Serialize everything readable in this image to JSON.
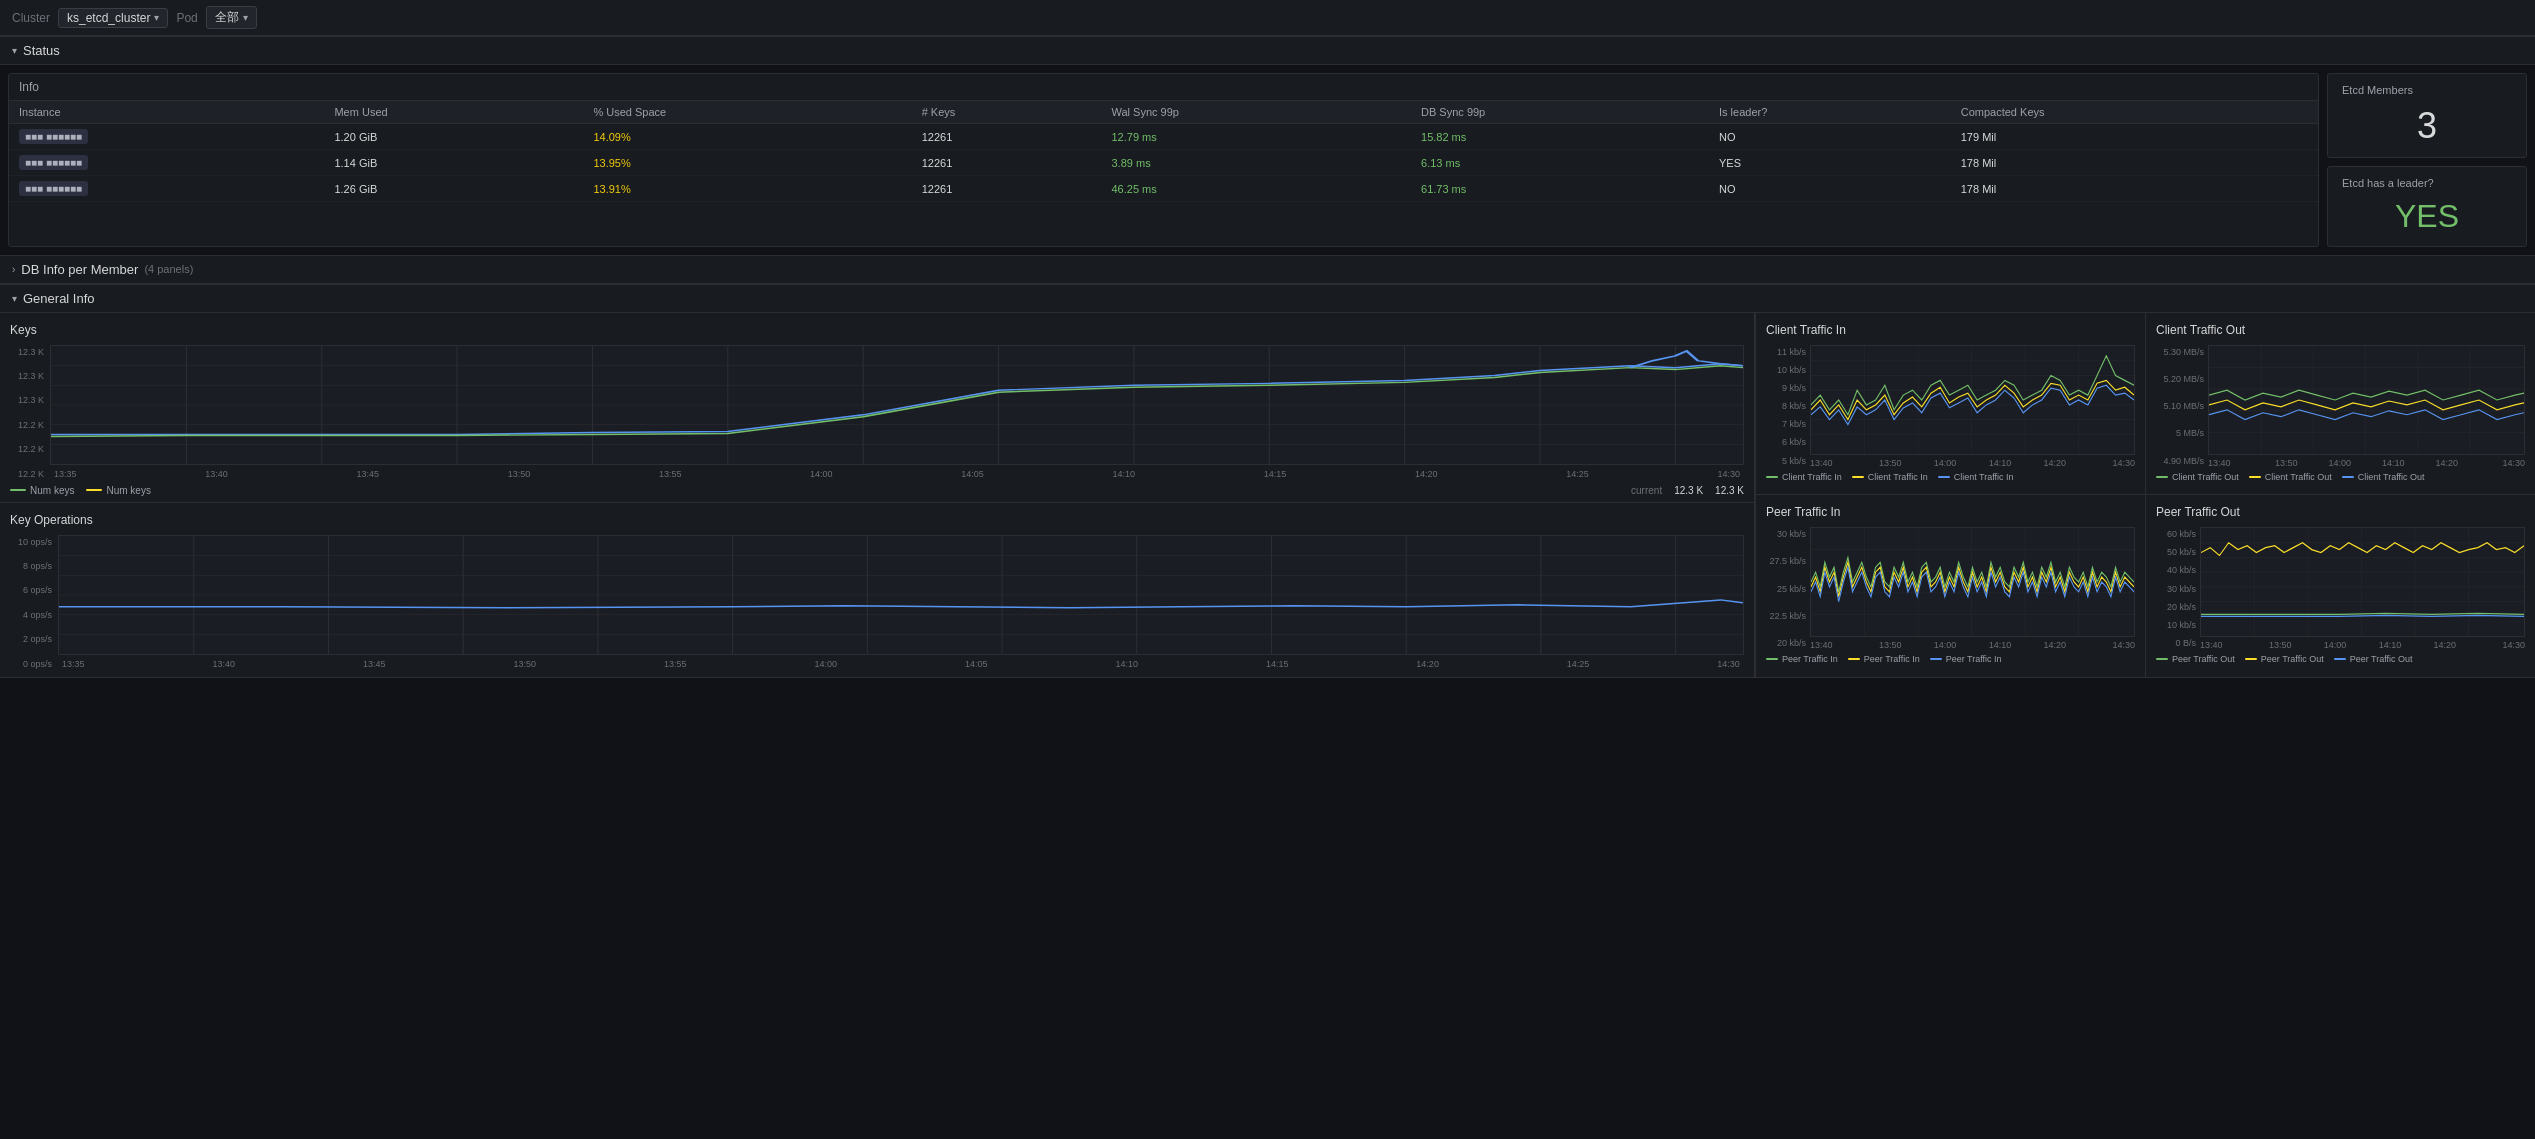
{
  "topbar": {
    "cluster_label": "Cluster",
    "cluster_value": "ks_etcd_cluster",
    "pod_label": "Pod",
    "all_label": "全部"
  },
  "status": {
    "section_title": "Status",
    "info_title": "Info",
    "table": {
      "headers": [
        "Instance",
        "Mem Used",
        "% Used Space",
        "# Keys",
        "Wal Sync 99p",
        "DB Sync 99p",
        "Is leader?",
        "Compacted Keys"
      ],
      "rows": [
        {
          "instance": "■■■ ■■■■■■",
          "mem_used": "1.20 GiB",
          "pct_used": "14.09%",
          "keys": "12261",
          "wal_sync": "12.79 ms",
          "db_sync": "15.82 ms",
          "is_leader": "NO",
          "compacted": "179 Mil"
        },
        {
          "instance": "■■■ ■■■■■■",
          "mem_used": "1.14 GiB",
          "pct_used": "13.95%",
          "keys": "12261",
          "wal_sync": "3.89 ms",
          "db_sync": "6.13 ms",
          "is_leader": "YES",
          "compacted": "178 Mil"
        },
        {
          "instance": "■■■ ■■■■■■",
          "mem_used": "1.26 GiB",
          "pct_used": "13.91%",
          "keys": "12261",
          "wal_sync": "46.25 ms",
          "db_sync": "61.73 ms",
          "is_leader": "NO",
          "compacted": "178 Mil"
        }
      ]
    },
    "etcd_members_title": "Etcd Members",
    "etcd_members_value": "3",
    "etcd_leader_title": "Etcd has a leader?",
    "etcd_leader_value": "YES"
  },
  "db_info": {
    "section_title": "DB Info per Member",
    "sub_label": "(4 panels)"
  },
  "general_info": {
    "section_title": "General Info",
    "keys_chart": {
      "title": "Keys",
      "y_labels": [
        "12.3 K",
        "12.3 K",
        "12.3 K",
        "12.2 K",
        "12.2 K",
        "12.2 K"
      ],
      "x_labels": [
        "13:35",
        "13:40",
        "13:45",
        "13:50",
        "13:55",
        "14:00",
        "14:05",
        "14:10",
        "14:15",
        "14:20",
        "14:25",
        "14:30"
      ],
      "legend": [
        {
          "label": "Num keys",
          "color": "#73bf69",
          "value": "12.3 K"
        },
        {
          "label": "Num keys",
          "color": "#fade2a",
          "value": "12.3 K"
        }
      ],
      "current_label": "current"
    },
    "key_ops_chart": {
      "title": "Key Operations",
      "y_labels": [
        "10 ops/s",
        "8 ops/s",
        "6 ops/s",
        "4 ops/s",
        "2 ops/s",
        "0 ops/s"
      ],
      "x_labels": [
        "13:35",
        "13:40",
        "13:45",
        "13:50",
        "13:55",
        "14:00",
        "14:05",
        "14:10",
        "14:15",
        "14:20",
        "14:25",
        "14:30"
      ]
    },
    "client_in_chart": {
      "title": "Client Traffic In",
      "y_labels": [
        "11 kb/s",
        "10 kb/s",
        "9 kb/s",
        "8 kb/s",
        "7 kb/s",
        "6 kb/s",
        "5 kb/s"
      ],
      "x_labels": [
        "13:40",
        "13:50",
        "14:00",
        "14:10",
        "14:20",
        "14:30"
      ],
      "legend": [
        {
          "label": "Client Traffic In",
          "color": "#73bf69"
        },
        {
          "label": "Client Traffic In",
          "color": "#fade2a"
        },
        {
          "label": "Client Traffic In",
          "color": "#5794f2"
        }
      ]
    },
    "client_out_chart": {
      "title": "Client Traffic Out",
      "y_labels": [
        "5.30 MB/s",
        "5.20 MB/s",
        "5.10 MB/s",
        "5 MB/s",
        "4.90 MB/s"
      ],
      "x_labels": [
        "13:40",
        "13:50",
        "14:00",
        "14:10",
        "14:20",
        "14:30"
      ],
      "legend": [
        {
          "label": "Client Traffic Out",
          "color": "#73bf69"
        },
        {
          "label": "Client Traffic Out",
          "color": "#fade2a"
        },
        {
          "label": "Client Traffic Out",
          "color": "#5794f2"
        }
      ]
    },
    "peer_in_chart": {
      "title": "Peer Traffic In",
      "y_labels": [
        "30 kb/s",
        "27.5 kb/s",
        "25 kb/s",
        "22.5 kb/s",
        "20 kb/s"
      ],
      "x_labels": [
        "13:40",
        "13:50",
        "14:00",
        "14:10",
        "14:20",
        "14:30"
      ],
      "legend": [
        {
          "label": "Peer Traffic In",
          "color": "#73bf69"
        },
        {
          "label": "Peer Traffic In",
          "color": "#fade2a"
        },
        {
          "label": "Peer Traffic In",
          "color": "#5794f2"
        }
      ]
    },
    "peer_out_chart": {
      "title": "Peer Traffic Out",
      "y_labels": [
        "60 kb/s",
        "50 kb/s",
        "40 kb/s",
        "30 kb/s",
        "20 kb/s",
        "10 kb/s",
        "0 B/s"
      ],
      "x_labels": [
        "13:40",
        "13:50",
        "14:00",
        "14:10",
        "14:20",
        "14:30"
      ],
      "legend": [
        {
          "label": "Peer Traffic Out",
          "color": "#73bf69"
        },
        {
          "label": "Peer Traffic Out",
          "color": "#fade2a"
        },
        {
          "label": "Peer Traffic Out",
          "color": "#5794f2"
        }
      ]
    }
  }
}
